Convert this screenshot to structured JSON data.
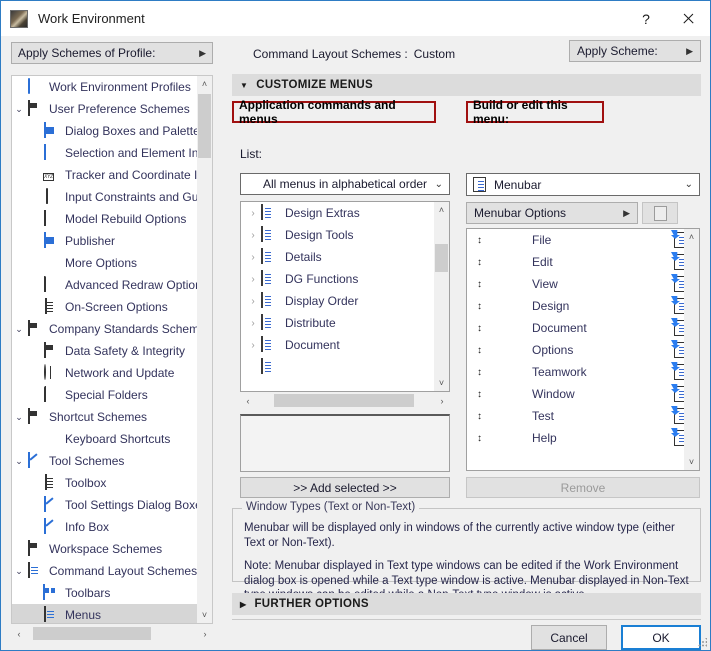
{
  "window": {
    "title": "Work Environment",
    "app_icon": "app-icon",
    "help_label": "?",
    "close_label": "close-icon"
  },
  "sidebar": {
    "profile_button": {
      "label": "Apply Schemes of Profile:",
      "arrow": "▶"
    },
    "items": [
      {
        "label": "Work Environment Profiles",
        "icon": "monitor-gear-icon",
        "indent": 0,
        "twisty": "",
        "selected": false
      },
      {
        "label": "User Preference Schemes",
        "icon": "user-schemes-icon",
        "indent": 0,
        "twisty": "⌄",
        "selected": false
      },
      {
        "label": "Dialog Boxes and Palettes",
        "icon": "dialog-boxes-icon",
        "indent": 1,
        "twisty": "",
        "selected": false
      },
      {
        "label": "Selection and Element Information",
        "icon": "selection-info-icon",
        "indent": 1,
        "twisty": "",
        "selected": false
      },
      {
        "label": "Tracker and Coordinate Input",
        "icon": "tracker-xyz-icon",
        "indent": 1,
        "twisty": "",
        "selected": false
      },
      {
        "label": "Input Constraints and Guides",
        "icon": "mouse-pointer-icon",
        "indent": 1,
        "twisty": "",
        "selected": false
      },
      {
        "label": "Model Rebuild Options",
        "icon": "brick-wall-icon",
        "indent": 1,
        "twisty": "",
        "selected": false
      },
      {
        "label": "Publisher",
        "icon": "publisher-icon",
        "indent": 1,
        "twisty": "",
        "selected": false
      },
      {
        "label": "More Options",
        "icon": "sliders-icon",
        "indent": 1,
        "twisty": "",
        "selected": false
      },
      {
        "label": "Advanced Redraw Options",
        "icon": "redraw-icon",
        "indent": 1,
        "twisty": "",
        "selected": false
      },
      {
        "label": "On-Screen Options",
        "icon": "on-screen-icon",
        "indent": 1,
        "twisty": "",
        "selected": false
      },
      {
        "label": "Company Standards Schemes",
        "icon": "company-standards-icon",
        "indent": 0,
        "twisty": "⌄",
        "selected": false
      },
      {
        "label": "Data Safety & Integrity",
        "icon": "data-safety-icon",
        "indent": 1,
        "twisty": "",
        "selected": false
      },
      {
        "label": "Network and Update",
        "icon": "globe-icon",
        "indent": 1,
        "twisty": "",
        "selected": false
      },
      {
        "label": "Special Folders",
        "icon": "folder-icon",
        "indent": 1,
        "twisty": "",
        "selected": false
      },
      {
        "label": "Shortcut Schemes",
        "icon": "shortcut-schemes-icon",
        "indent": 0,
        "twisty": "⌄",
        "selected": false
      },
      {
        "label": "Keyboard Shortcuts",
        "icon": "keyboard-shortcut-icon",
        "indent": 1,
        "twisty": "",
        "selected": false
      },
      {
        "label": "Tool Schemes",
        "icon": "tool-schemes-icon",
        "indent": 0,
        "twisty": "⌄",
        "selected": false
      },
      {
        "label": "Toolbox",
        "icon": "toolbox-icon",
        "indent": 1,
        "twisty": "",
        "selected": false
      },
      {
        "label": "Tool Settings Dialog Boxes",
        "icon": "tool-settings-icon",
        "indent": 1,
        "twisty": "",
        "selected": false
      },
      {
        "label": "Info Box",
        "icon": "info-box-icon",
        "indent": 1,
        "twisty": "",
        "selected": false
      },
      {
        "label": "Workspace Schemes",
        "icon": "workspace-schemes-icon",
        "indent": 0,
        "twisty": "",
        "selected": false
      },
      {
        "label": "Command Layout Schemes",
        "icon": "command-layout-icon",
        "indent": 0,
        "twisty": "⌄",
        "selected": false
      },
      {
        "label": "Toolbars",
        "icon": "toolbars-icon",
        "indent": 1,
        "twisty": "",
        "selected": false
      },
      {
        "label": "Menus",
        "icon": "menus-icon",
        "indent": 1,
        "twisty": "",
        "selected": true
      }
    ],
    "scroll": {
      "up": "˄",
      "down": "˅",
      "left": "‹",
      "right": "›"
    }
  },
  "main": {
    "scheme_line": {
      "label": "Command Layout Schemes :",
      "value": "Custom"
    },
    "apply_scheme_button": {
      "label": "Apply Scheme:",
      "arrow": "▶"
    },
    "section": {
      "caret": "▼",
      "title": "CUSTOMIZE MENUS"
    },
    "further_section": {
      "caret": "▶",
      "title": "FURTHER OPTIONS"
    },
    "left_panel": {
      "red_header": "Application commands and menus",
      "list_label": "List:",
      "filter_dropdown": {
        "value": "All menus in alphabetical order",
        "chevron": "⌄"
      },
      "items": [
        {
          "label": "Design Extras",
          "expander": "›",
          "icon": "menu-doc-icon"
        },
        {
          "label": "Design Tools",
          "expander": "›",
          "icon": "menu-doc-icon"
        },
        {
          "label": "Details",
          "expander": "›",
          "icon": "menu-doc-icon"
        },
        {
          "label": "DG Functions",
          "expander": "›",
          "icon": "menu-doc-icon"
        },
        {
          "label": "Display Order",
          "expander": "›",
          "icon": "menu-doc-icon"
        },
        {
          "label": "Distribute",
          "expander": "›",
          "icon": "menu-doc-icon"
        },
        {
          "label": "Document",
          "expander": "›",
          "icon": "menu-doc-icon"
        }
      ],
      "add_button": ">> Add selected >>",
      "description_value": ""
    },
    "right_panel": {
      "red_header": "Build or edit this menu:",
      "menu_dropdown": {
        "value": "Menubar",
        "icon": "menubar-icon",
        "chevron": "⌄"
      },
      "options_button": {
        "label": "Menubar Options",
        "arrow": "▶"
      },
      "edit_button_icon": "edit-page-icon",
      "items": [
        {
          "label": "File",
          "drag": "↕",
          "icon": "jump-to-icon"
        },
        {
          "label": "Edit",
          "drag": "↕",
          "icon": "jump-to-icon"
        },
        {
          "label": "View",
          "drag": "↕",
          "icon": "jump-to-icon"
        },
        {
          "label": "Design",
          "drag": "↕",
          "icon": "jump-to-icon"
        },
        {
          "label": "Document",
          "drag": "↕",
          "icon": "jump-to-icon"
        },
        {
          "label": "Options",
          "drag": "↕",
          "icon": "jump-to-icon"
        },
        {
          "label": "Teamwork",
          "drag": "↕",
          "icon": "jump-to-icon"
        },
        {
          "label": "Window",
          "drag": "↕",
          "icon": "jump-to-icon"
        },
        {
          "label": "Test",
          "drag": "↕",
          "icon": "jump-to-icon"
        },
        {
          "label": "Help",
          "drag": "↕",
          "icon": "jump-to-icon"
        }
      ],
      "remove_button": "Remove"
    },
    "info_group": {
      "title": "Window Types (Text or Non-Text)",
      "paragraph1": "Menubar will be displayed only in windows of the currently active window type (either Text or Non-Text).",
      "paragraph2": "Note: Menubar displayed in Text type windows can be edited if the Work Environment dialog box is opened while a Text type window is active. Menubar displayed in Non-Text type windows can be edited while a Non-Text type window is active."
    },
    "footer": {
      "cancel": "Cancel",
      "ok": "OK"
    }
  },
  "colors": {
    "accent_blue": "#1a7fd4",
    "red_highlight": "#a01010",
    "panel_bg": "#f0f0f0",
    "section_bg": "#dcdcdc",
    "selection_bg": "#d6d6d6",
    "list_text": "#33335c"
  }
}
